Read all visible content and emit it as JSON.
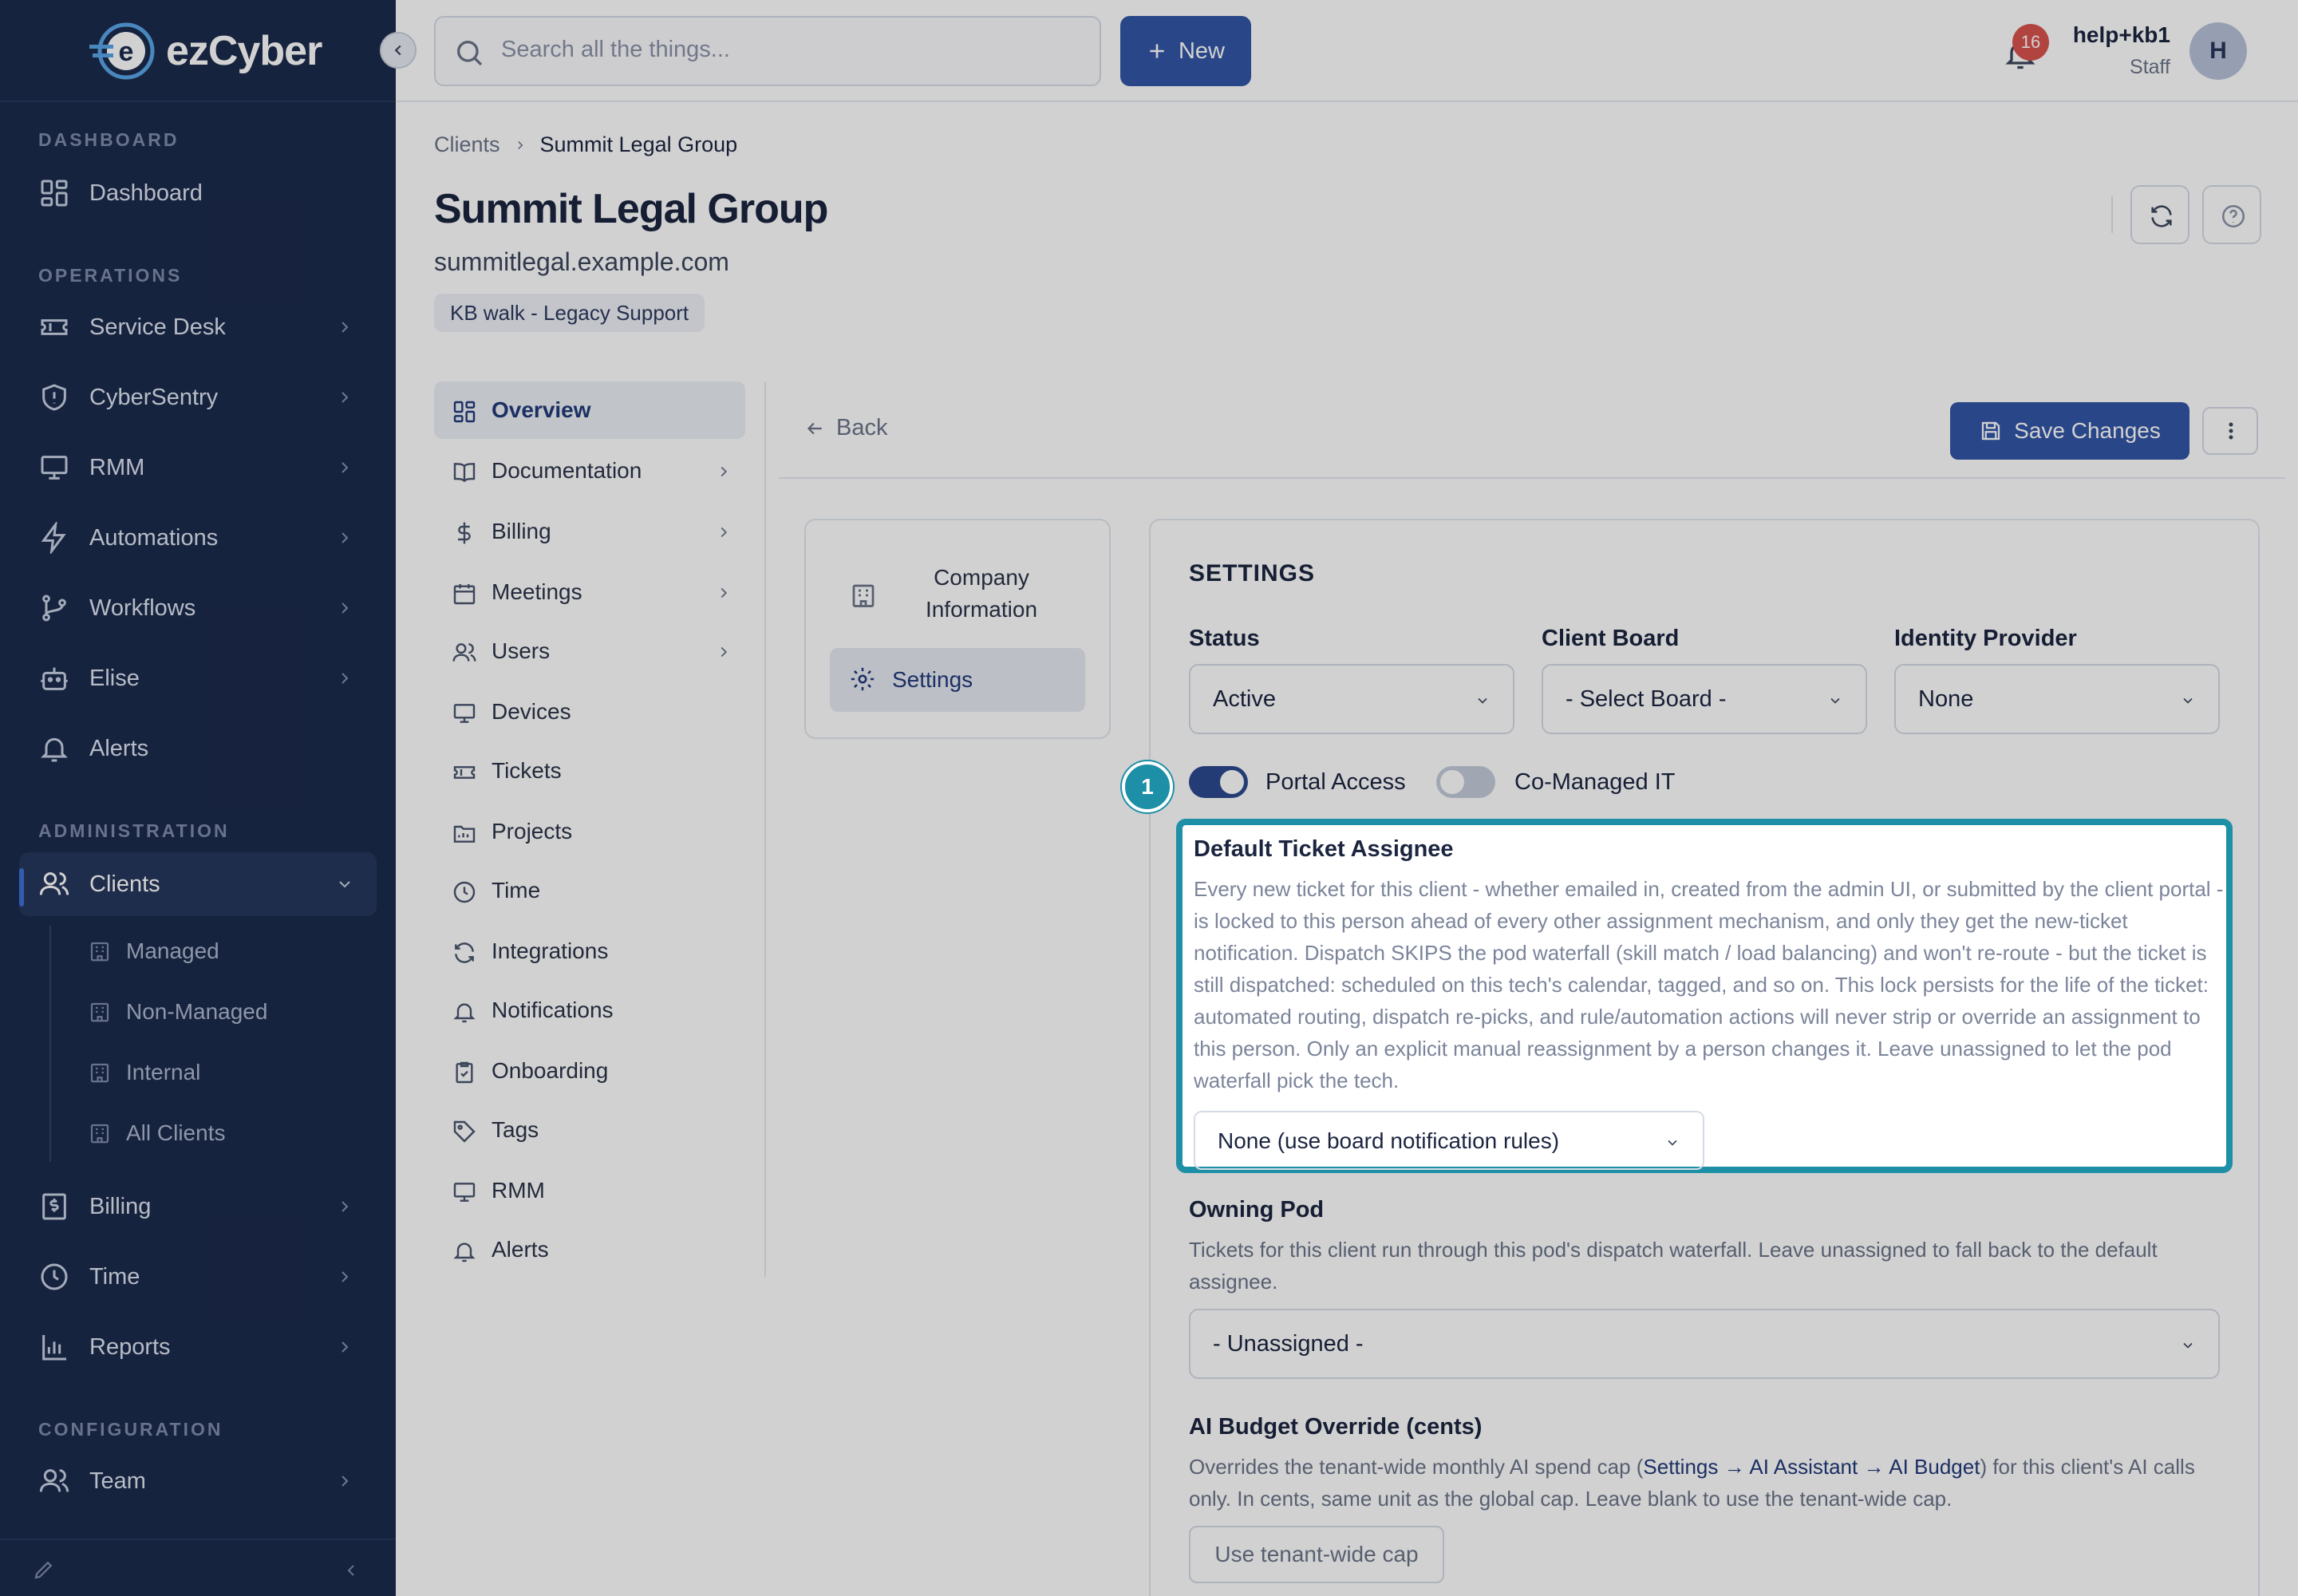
{
  "brand": {
    "name": "ezCyber",
    "logo_letter": "e"
  },
  "search": {
    "placeholder": "Search all the things..."
  },
  "header": {
    "new_label": "New",
    "notification_count": "16",
    "user_name": "help+kb1",
    "user_role": "Staff",
    "avatar_initial": "H"
  },
  "sidebar": {
    "sections": {
      "dashboard": "DASHBOARD",
      "operations": "OPERATIONS",
      "administration": "ADMINISTRATION",
      "configuration": "CONFIGURATION"
    },
    "items": [
      {
        "label": "Dashboard",
        "icon": "dashboard-icon"
      },
      {
        "label": "Service Desk",
        "icon": "ticket-icon"
      },
      {
        "label": "CyberSentry",
        "icon": "shield-icon"
      },
      {
        "label": "RMM",
        "icon": "monitor-icon"
      },
      {
        "label": "Automations",
        "icon": "bolt-icon"
      },
      {
        "label": "Workflows",
        "icon": "workflow-icon"
      },
      {
        "label": "Elise",
        "icon": "robot-icon"
      },
      {
        "label": "Alerts",
        "icon": "bell-icon"
      },
      {
        "label": "Clients",
        "icon": "users-icon"
      },
      {
        "label": "Billing",
        "icon": "billing-icon"
      },
      {
        "label": "Time",
        "icon": "clock-icon"
      },
      {
        "label": "Reports",
        "icon": "chart-icon"
      },
      {
        "label": "Team",
        "icon": "team-icon"
      }
    ],
    "client_sub": [
      "Managed",
      "Non-Managed",
      "Internal",
      "All Clients"
    ]
  },
  "breadcrumb": {
    "parent": "Clients",
    "current": "Summit Legal Group"
  },
  "client": {
    "name": "Summit Legal Group",
    "domain": "summitlegal.example.com",
    "tag": "KB walk - Legacy Support"
  },
  "client_nav": [
    "Overview",
    "Documentation",
    "Billing",
    "Meetings",
    "Users",
    "Devices",
    "Tickets",
    "Projects",
    "Time",
    "Integrations",
    "Notifications",
    "Onboarding",
    "Tags",
    "RMM",
    "Alerts"
  ],
  "toolbar": {
    "back_label": "Back",
    "save_label": "Save Changes"
  },
  "tabs": {
    "company": "Company Information",
    "settings": "Settings"
  },
  "settings": {
    "title": "SETTINGS",
    "status": {
      "label": "Status",
      "value": "Active"
    },
    "client_board": {
      "label": "Client Board",
      "value": "- Select Board -"
    },
    "identity_provider": {
      "label": "Identity Provider",
      "value": "None"
    },
    "portal_access": {
      "label": "Portal Access",
      "on": true
    },
    "co_managed": {
      "label": "Co-Managed IT",
      "on": false
    },
    "step_number": "1",
    "default_assignee": {
      "label": "Default Ticket Assignee",
      "description": "Every new ticket for this client - whether emailed in, created from the admin UI, or submitted by the client portal - is locked to this person ahead of every other assignment mechanism, and only they get the new-ticket notification. Dispatch SKIPS the pod waterfall (skill match / load balancing) and won't re-route - but the ticket is still dispatched: scheduled on this tech's calendar, tagged, and so on. This lock persists for the life of the ticket: automated routing, dispatch re-picks, and rule/automation actions will never strip or override an assignment to this person. Only an explicit manual reassignment by a person changes it. Leave unassigned to let the pod waterfall pick the tech.",
      "value": "None (use board notification rules)"
    },
    "owning_pod": {
      "label": "Owning Pod",
      "description": "Tickets for this client run through this pod's dispatch waterfall. Leave unassigned to fall back to the default assignee.",
      "value": "- Unassigned -"
    },
    "ai_budget": {
      "label": "AI Budget Override (cents)",
      "desc_pre": "Overrides the tenant-wide monthly AI spend cap (",
      "desc_link": "Settings → AI Assistant → AI Budget",
      "desc_post": ") for this client's AI calls only. In cents, same unit as the global cap. Leave blank to use the tenant-wide cap.",
      "placeholder": "Use tenant-wide cap"
    }
  },
  "colors": {
    "sidebar_bg": "#1c2b4c",
    "primary": "#3356a7",
    "highlight": "#1d8fa6",
    "badge": "#d9534f"
  }
}
